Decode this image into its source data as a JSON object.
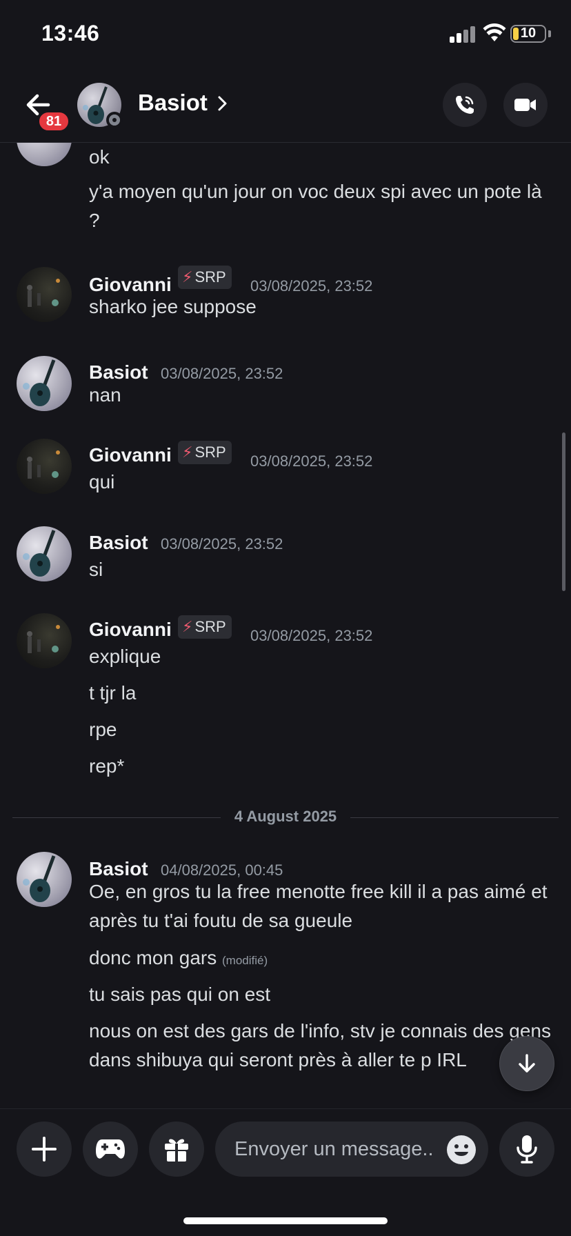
{
  "status_bar": {
    "time": "13:46",
    "battery": "10"
  },
  "header": {
    "title": "Basiot",
    "unread_badge": "81",
    "icons": [
      "back-arrow-icon",
      "chevron-right-icon",
      "phone-call-icon",
      "video-camera-icon"
    ]
  },
  "messages": {
    "top_continuation": [
      "ok",
      "y'a moyen qu'un jour on voc deux spi avec un pote là ?"
    ],
    "groups": [
      {
        "author": "Giovanni",
        "tag": "SRP",
        "time": "03/08/2025, 23:52",
        "lines": [
          "sharko jee suppose"
        ]
      },
      {
        "author": "Basiot",
        "time": "03/08/2025, 23:52",
        "lines": [
          "nan"
        ]
      },
      {
        "author": "Giovanni",
        "tag": "SRP",
        "time": "03/08/2025, 23:52",
        "lines": [
          "qui"
        ]
      },
      {
        "author": "Basiot",
        "time": "03/08/2025, 23:52",
        "lines": [
          "si"
        ]
      },
      {
        "author": "Giovanni",
        "tag": "SRP",
        "time": "03/08/2025, 23:52",
        "lines": [
          "explique",
          "t tjr la",
          "rpe",
          "rep*"
        ]
      }
    ],
    "date_divider": "4 August 2025",
    "last_group": {
      "author": "Basiot",
      "time": "04/08/2025, 00:45",
      "lines": [
        "Oe, en gros tu la free menotte free kill il a pas aimé et après tu t'ai foutu de sa gueule",
        "donc mon gars",
        "tu sais pas qui on est",
        "nous on est des gars de l'info, stv je connais des gens dans shibuya qui seront près à aller te p IRL"
      ],
      "edited_label": "(modifié)"
    }
  },
  "composer": {
    "placeholder": "Envoyer un message..",
    "icons": [
      "plus-icon",
      "gamepad-icon",
      "gift-icon",
      "emoji-icon",
      "microphone-icon"
    ]
  },
  "colors": {
    "background": "#15151a",
    "badge": "#e5383f",
    "tag_bolt": "#ef5a6f"
  }
}
